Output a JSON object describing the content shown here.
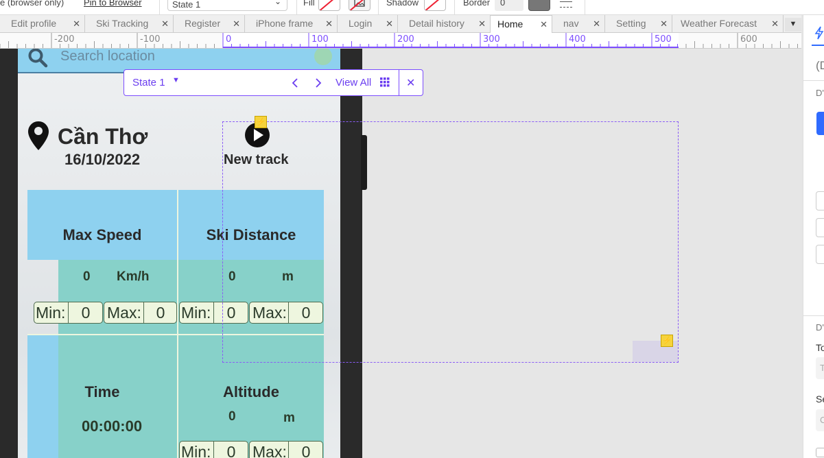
{
  "toolbar": {
    "browser_only": "e (browser only)",
    "pin_to_browser": "Pin to Browser",
    "state_value": "State 1",
    "fill_label": "Fill",
    "shadow_label": "Shadow",
    "border_label": "Border",
    "border_value": "0",
    "border_color": "#777777"
  },
  "tabs": [
    {
      "label": "Edit profile",
      "active": false
    },
    {
      "label": "Ski Tracking",
      "active": false
    },
    {
      "label": "Register",
      "active": false
    },
    {
      "label": "iPhone frame",
      "active": false
    },
    {
      "label": "Login",
      "active": false
    },
    {
      "label": "Detail history",
      "active": false
    },
    {
      "label": "Home",
      "active": true
    },
    {
      "label": "nav",
      "active": false
    },
    {
      "label": "Setting",
      "active": false
    },
    {
      "label": "Weather Forecast",
      "active": false
    }
  ],
  "ruler": {
    "labels": [
      "-200",
      "-100",
      "0",
      "100",
      "200",
      "300",
      "400",
      "500",
      "600"
    ]
  },
  "state_bar": {
    "state_label": "State 1",
    "view_all": "View All"
  },
  "app": {
    "search_placeholder": "Search location",
    "city": "Cần Thơ",
    "date": "16/10/2022",
    "new_track": "New track",
    "max_speed": {
      "title": "Max Speed",
      "value": "0",
      "unit": "Km/h",
      "min_label": "Min:",
      "min_value": "0",
      "max_label": "Max:",
      "max_value": "0"
    },
    "ski_distance": {
      "title": "Ski Distance",
      "value": "0",
      "unit": "m",
      "min_label": "Min:",
      "min_value": "0",
      "max_label": "Max:",
      "max_value": "0"
    },
    "time": {
      "title": "Time",
      "value": "00:00:00"
    },
    "altitude": {
      "title": "Altitude",
      "value": "0",
      "unit": "m",
      "min_label": "Min:",
      "min_value": "0",
      "max_label": "Max:",
      "max_value": "0"
    }
  },
  "right_panel": {
    "label_1": "(D",
    "label_2": "D'",
    "label_3": "D'",
    "label_4": "To",
    "label_5": "T",
    "label_6": "Se",
    "label_7": "C"
  },
  "colors": {
    "accent": "#7c4dff",
    "header_blue": "#8ed1ef",
    "teal": "#87d1c9",
    "bolt_yellow": "#f6d33c"
  }
}
